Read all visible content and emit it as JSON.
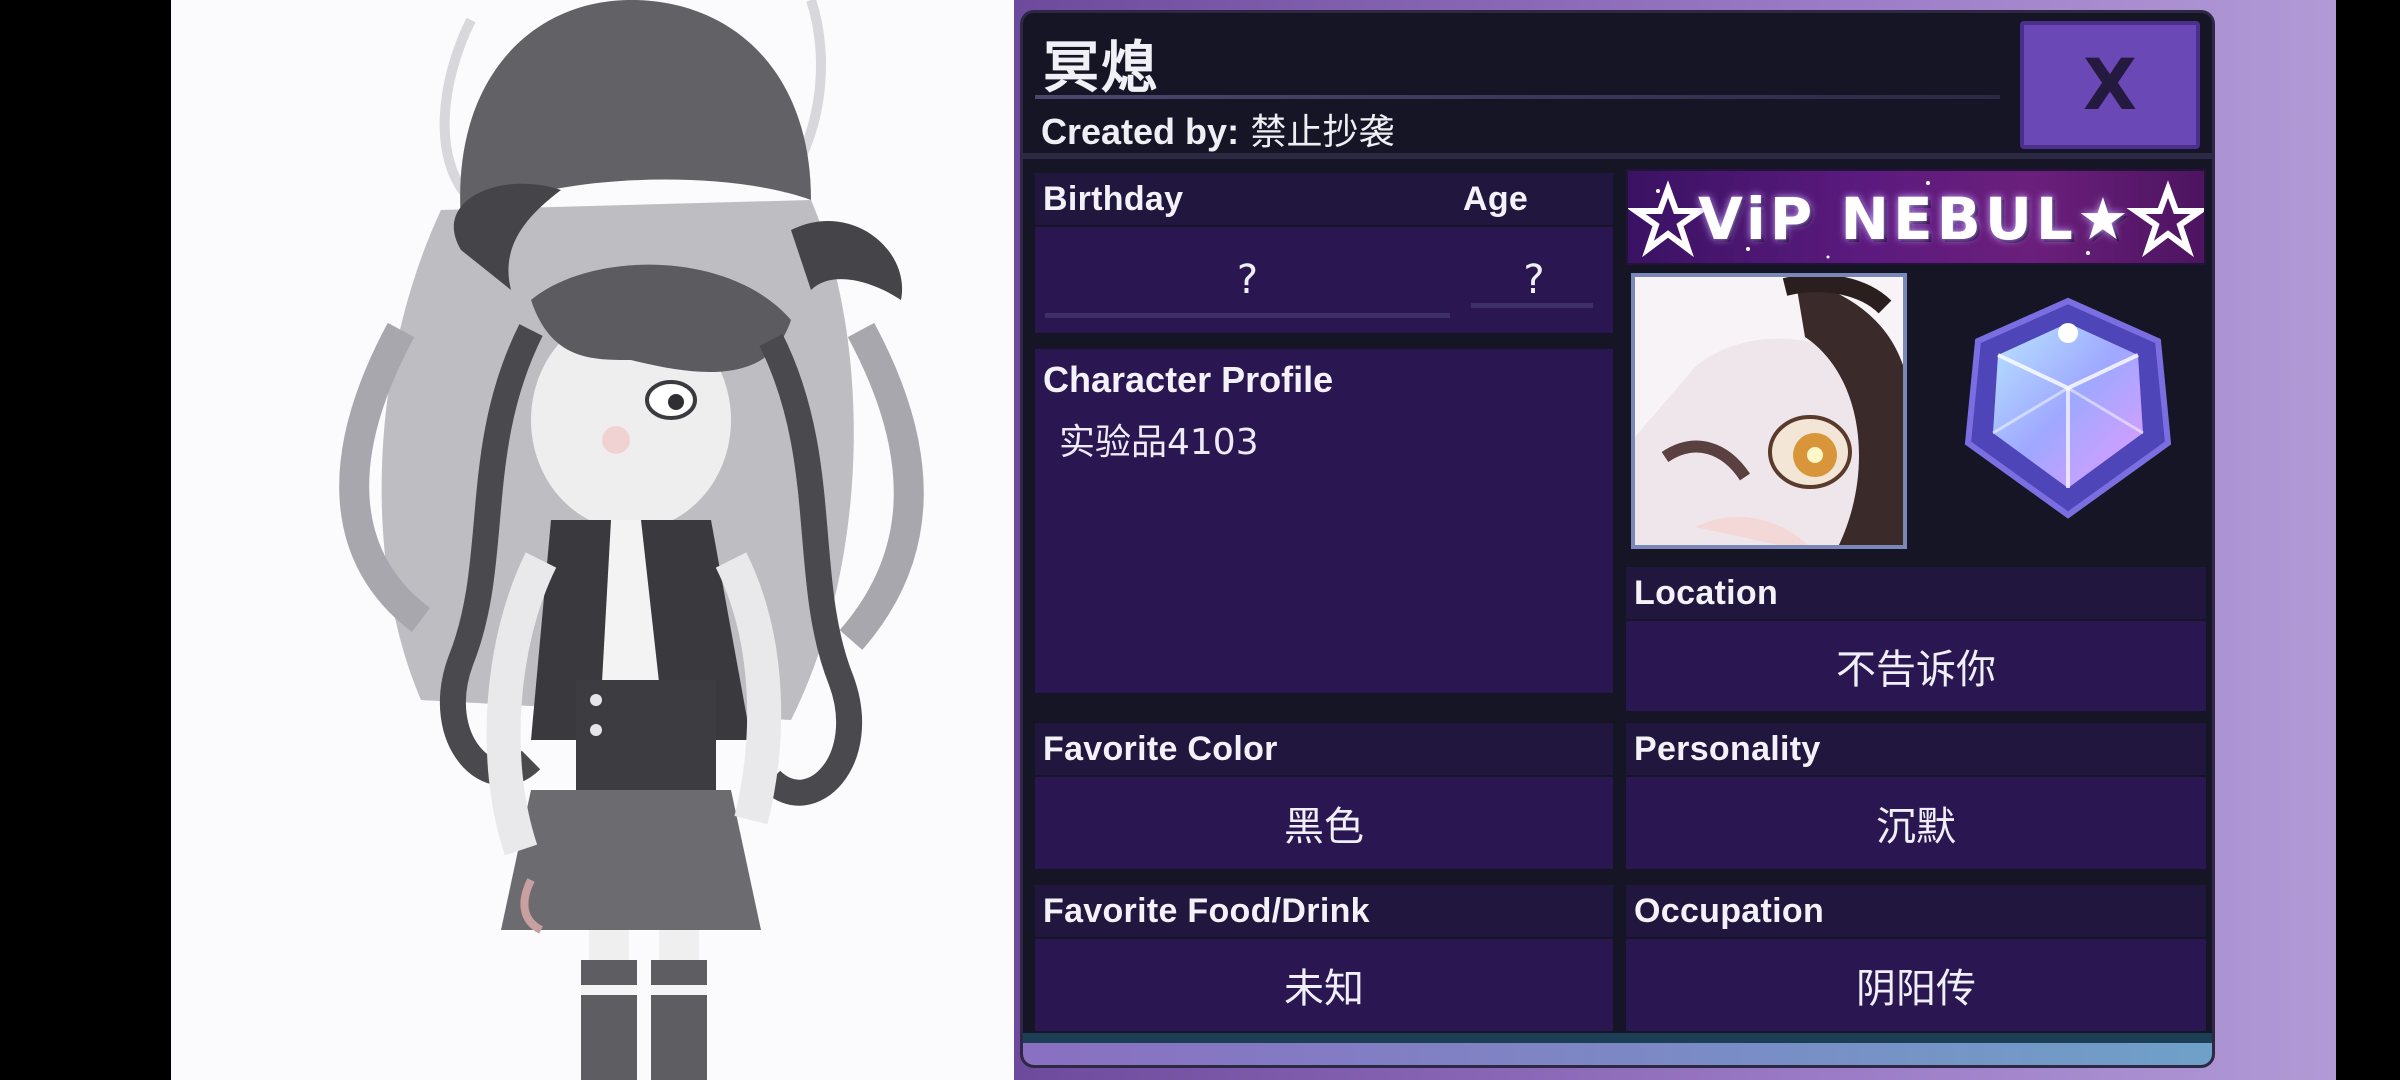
{
  "character": {
    "name": "冥熄",
    "created_by_label": "Created by:",
    "created_by_value": "禁止抄袭"
  },
  "close_button": {
    "label": "X"
  },
  "fields": {
    "birthday": {
      "label": "Birthday",
      "value": "?"
    },
    "age": {
      "label": "Age",
      "value": "?"
    },
    "character_profile": {
      "label": "Character Profile",
      "value": "实验品4103"
    },
    "location": {
      "label": "Location",
      "value": "不告诉你"
    },
    "favorite_color": {
      "label": "Favorite Color",
      "value": "黑色"
    },
    "personality": {
      "label": "Personality",
      "value": "沉默"
    },
    "favorite_food": {
      "label": "Favorite Food/Drink",
      "value": "未知"
    },
    "occupation": {
      "label": "Occupation",
      "value": "阴阳传"
    }
  },
  "badge": {
    "banner_text": "ViP NEBUL★",
    "icon": "nebula-gem-icon"
  },
  "colors": {
    "card_bg": "#151525",
    "field_bg": "#2a1752",
    "label_bg": "#21163e",
    "accent": "#6a48b6"
  }
}
